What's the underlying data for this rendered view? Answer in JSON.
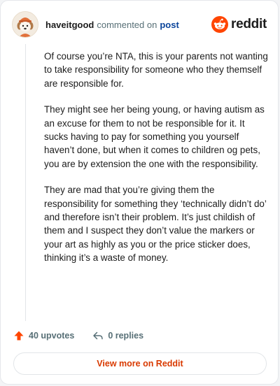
{
  "header": {
    "username": "haveitgood",
    "action_text": "commented on",
    "link_text": "post",
    "brand_name": "reddit"
  },
  "comment": {
    "paragraphs": [
      "Of course you’re NTA, this is your parents not wanting to take responsibility for someone who they themself are responsible for.",
      "They might see her being young, or having autism as an excuse for them to not be responsible for it. It sucks having to pay for something you yourself haven’t done, but when it comes to children og pets, you are by extension the one with the responsibility.",
      "They are mad that you’re giving them the responsibility for something they ‘technically didn’t do’ and therefore isn’t their problem. It’s just childish of them and I suspect they don’t value the markers or your art as highly as you or the price sticker does, thinking it’s a waste of money."
    ]
  },
  "actions": {
    "upvotes_label": "40 upvotes",
    "replies_label": "0 replies"
  },
  "footer": {
    "view_more_label": "View more on Reddit"
  },
  "icons": {
    "upvote": "arrow-up-icon",
    "reply": "reply-arrow-icon",
    "brand": "reddit-snoo-icon",
    "avatar": "dog-avatar-icon"
  },
  "colors": {
    "accent": "#d93a00",
    "upvote": "#ff4500",
    "link": "#0a449b",
    "muted": "#576f76"
  }
}
